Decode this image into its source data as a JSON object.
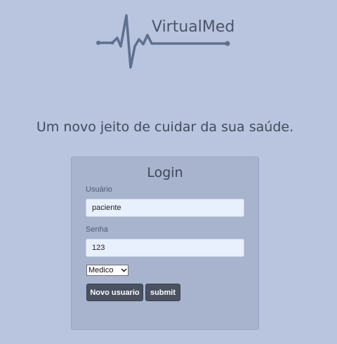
{
  "brand": {
    "name": "VirtualMed"
  },
  "tagline": "Um novo jeito de cuidar da sua saúde.",
  "login": {
    "title": "Login",
    "username_label": "Usuário",
    "username_value": "paciente",
    "password_label": "Senha",
    "password_value": "123",
    "role_selected": "Medico",
    "new_user_button": "Novo usuario",
    "submit_button": "submit"
  },
  "colors": {
    "background": "#b9c5de",
    "card": "#a8b3cd",
    "button": "#4a5160",
    "input": "#e8f0fe"
  }
}
